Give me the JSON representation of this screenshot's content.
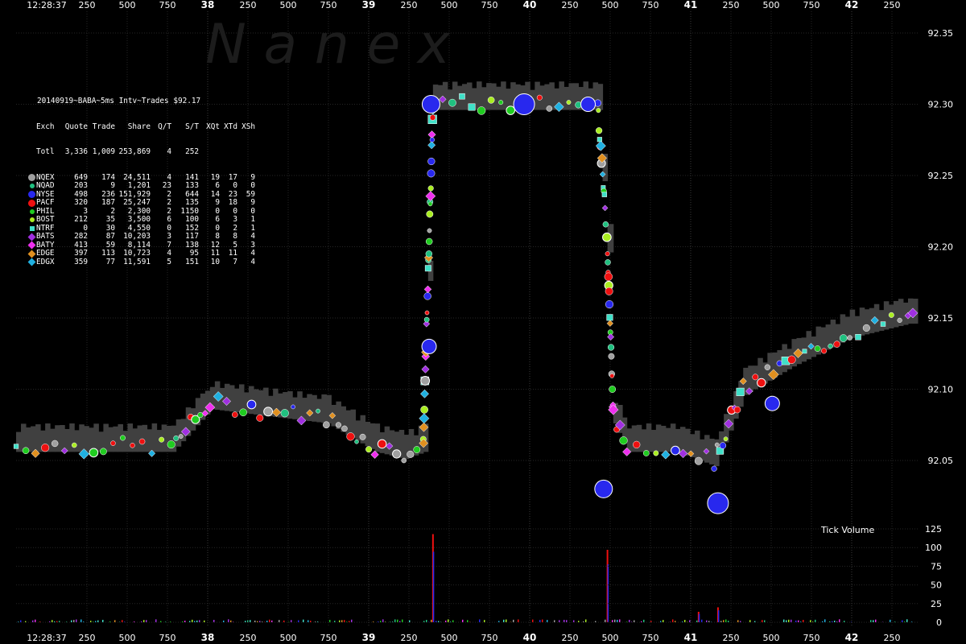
{
  "chart_data": {
    "type": "scatter",
    "title": "20140919~BABA~5ms Intv~Trades $92.17",
    "watermark": "N  a  n  e  x",
    "time_start": "12:28:37",
    "x_ticks_top": [
      "12:28:37",
      "250",
      "500",
      "750",
      "38",
      "250",
      "500",
      "750",
      "39",
      "250",
      "500",
      "750",
      "40",
      "250",
      "500",
      "750",
      "41",
      "250",
      "500",
      "750",
      "42",
      "250"
    ],
    "x_ticks_bottom": [
      "12:28:37",
      "250",
      "500",
      "750",
      "38",
      "250",
      "500",
      "750",
      "39",
      "250",
      "500",
      "750",
      "40",
      "250",
      "500",
      "750",
      "41",
      "250",
      "500",
      "750",
      "42",
      "250"
    ],
    "y_ticks": [
      "92.35",
      "92.30",
      "92.25",
      "92.20",
      "92.15",
      "92.10",
      "92.05"
    ],
    "ylim": [
      92.02,
      92.35
    ],
    "volume_label": "Tick Volume",
    "volume_ticks": [
      "125",
      "100",
      "75",
      "50",
      "25",
      "0"
    ],
    "volume_ylim": [
      0,
      125
    ],
    "colors": {
      "background": "#000000",
      "nbbo_band": "#404040",
      "NQEX": "#a0a0a0",
      "NQAD": "#20c080",
      "NYSE": "#2828ee",
      "PACF": "#ee1010",
      "PHIL": "#20cc20",
      "BOST": "#aaee22",
      "NTRF": "#40e0c8",
      "BATS": "#a030e0",
      "BATY": "#ee30ee",
      "EDGE": "#e09020",
      "EDGX": "#20b0e0"
    },
    "table": {
      "headers": [
        "Exch",
        "Quote",
        "Trade",
        "Share",
        "Q/T",
        "S/T",
        "XQt",
        "XTd",
        "XSh"
      ],
      "total": [
        "Totl",
        "3,336",
        "1,009",
        "253,869",
        "4",
        "252",
        "",
        "",
        ""
      ],
      "rows": [
        {
          "exch": "NQEX",
          "marker": "circle",
          "color": "#a0a0a0",
          "values": [
            "649",
            "174",
            "24,511",
            "4",
            "141",
            "19",
            "17",
            "9"
          ]
        },
        {
          "exch": "NQAD",
          "marker": "circle-small",
          "color": "#20c080",
          "values": [
            "203",
            "9",
            "1,201",
            "23",
            "133",
            "6",
            "0",
            "0"
          ]
        },
        {
          "exch": "NYSE",
          "marker": "circle",
          "color": "#2828ee",
          "values": [
            "498",
            "236",
            "151,929",
            "2",
            "644",
            "14",
            "23",
            "59"
          ]
        },
        {
          "exch": "PACF",
          "marker": "circle",
          "color": "#ee1010",
          "values": [
            "320",
            "187",
            "25,247",
            "2",
            "135",
            "9",
            "18",
            "9"
          ]
        },
        {
          "exch": "PHIL",
          "marker": "circle-small",
          "color": "#20cc20",
          "values": [
            "3",
            "2",
            "2,300",
            "2",
            "1150",
            "0",
            "0",
            "0"
          ]
        },
        {
          "exch": "BOST",
          "marker": "circle-small",
          "color": "#aaee22",
          "values": [
            "212",
            "35",
            "3,500",
            "6",
            "100",
            "6",
            "3",
            "1"
          ]
        },
        {
          "exch": "NTRF",
          "marker": "square",
          "color": "#40e0c8",
          "values": [
            "0",
            "30",
            "4,550",
            "0",
            "152",
            "0",
            "2",
            "1"
          ]
        },
        {
          "exch": "BATS",
          "marker": "diamond",
          "color": "#a030e0",
          "values": [
            "282",
            "87",
            "10,203",
            "3",
            "117",
            "8",
            "8",
            "4"
          ]
        },
        {
          "exch": "BATY",
          "marker": "diamond",
          "color": "#ee30ee",
          "values": [
            "413",
            "59",
            "8,114",
            "7",
            "138",
            "12",
            "5",
            "3"
          ]
        },
        {
          "exch": "EDGE",
          "marker": "diamond",
          "color": "#e09020",
          "values": [
            "397",
            "113",
            "10,723",
            "4",
            "95",
            "11",
            "11",
            "4"
          ]
        },
        {
          "exch": "EDGX",
          "marker": "diamond",
          "color": "#20b0e0",
          "values": [
            "359",
            "77",
            "11,591",
            "5",
            "151",
            "10",
            "7",
            "4"
          ]
        }
      ]
    },
    "price_path": [
      {
        "t": 0,
        "p": 92.06
      },
      {
        "t": 800,
        "p": 92.06
      },
      {
        "t": 1000,
        "p": 92.09
      },
      {
        "t": 1600,
        "p": 92.08
      },
      {
        "t": 1850,
        "p": 92.06
      },
      {
        "t": 2000,
        "p": 92.055
      },
      {
        "t": 2100,
        "p": 92.06
      },
      {
        "t": 2150,
        "p": 92.3
      },
      {
        "t": 3000,
        "p": 92.3
      },
      {
        "t": 3050,
        "p": 92.2
      },
      {
        "t": 3080,
        "p": 92.08
      },
      {
        "t": 3150,
        "p": 92.06
      },
      {
        "t": 3400,
        "p": 92.06
      },
      {
        "t": 3600,
        "p": 92.05
      },
      {
        "t": 3750,
        "p": 92.1
      },
      {
        "t": 4000,
        "p": 92.12
      },
      {
        "t": 4300,
        "p": 92.14
      },
      {
        "t": 4600,
        "p": 92.15
      },
      {
        "t": 4650,
        "p": 92.15
      }
    ],
    "volume_spikes": [
      {
        "t": 2150,
        "v": 118
      },
      {
        "t": 3050,
        "v": 97
      },
      {
        "t": 3620,
        "v": 20
      },
      {
        "t": 3520,
        "v": 14
      }
    ]
  }
}
